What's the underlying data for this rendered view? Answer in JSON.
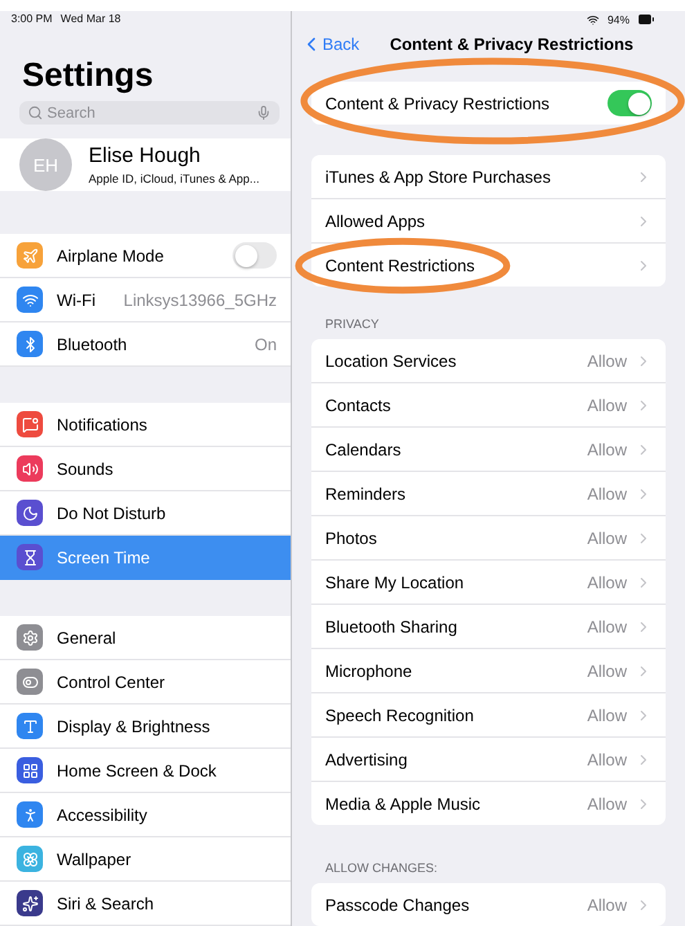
{
  "status_bar": {
    "time": "3:00 PM",
    "date": "Wed Mar 18",
    "battery": "94%"
  },
  "sidebar": {
    "title": "Settings",
    "search": {
      "placeholder": "Search"
    },
    "profile": {
      "initials": "EH",
      "name": "Elise Hough",
      "subtitle": "Apple ID, iCloud, iTunes & App..."
    },
    "groups": [
      [
        {
          "label": "Airplane Mode",
          "kind": "toggle",
          "on": false,
          "color": "#f7a23a",
          "selected": false
        },
        {
          "label": "Wi-Fi",
          "kind": "value",
          "value": "Linksys13966_5GHz",
          "color": "#2f86f0",
          "selected": false
        },
        {
          "label": "Bluetooth",
          "kind": "value",
          "value": "On",
          "color": "#2f86f0",
          "selected": false
        }
      ],
      [
        {
          "label": "Notifications",
          "kind": "plain",
          "color": "#ee4b3f",
          "selected": false
        },
        {
          "label": "Sounds",
          "kind": "plain",
          "color": "#ec3b5c",
          "selected": false
        },
        {
          "label": "Do Not Disturb",
          "kind": "plain",
          "color": "#5a4fd0",
          "selected": false
        },
        {
          "label": "Screen Time",
          "kind": "plain",
          "color": "#5a4fd0",
          "selected": true
        }
      ],
      [
        {
          "label": "General",
          "kind": "plain",
          "color": "#8e8e93",
          "selected": false
        },
        {
          "label": "Control Center",
          "kind": "plain",
          "color": "#8e8e93",
          "selected": false
        },
        {
          "label": "Display & Brightness",
          "kind": "plain",
          "color": "#2f86f0",
          "selected": false
        },
        {
          "label": "Home Screen & Dock",
          "kind": "plain",
          "color": "#3a5ee0",
          "selected": false
        },
        {
          "label": "Accessibility",
          "kind": "plain",
          "color": "#2f86f0",
          "selected": false
        },
        {
          "label": "Wallpaper",
          "kind": "plain",
          "color": "#3bb3e0",
          "selected": false
        },
        {
          "label": "Siri & Search",
          "kind": "plain",
          "color": "#3a3a8c",
          "selected": false
        }
      ]
    ]
  },
  "detail": {
    "back": "Back",
    "title": "Content & Privacy Restrictions",
    "sections": [
      {
        "rows": [
          {
            "label": "Content & Privacy Restrictions",
            "kind": "toggle",
            "on": true,
            "circled": true
          }
        ]
      },
      {
        "rows": [
          {
            "label": "iTunes & App Store Purchases",
            "kind": "link",
            "circled": false
          },
          {
            "label": "Allowed Apps",
            "kind": "link",
            "circled": false
          },
          {
            "label": "Content Restrictions",
            "kind": "link",
            "circled": true
          }
        ]
      },
      {
        "header": "PRIVACY",
        "rows": [
          {
            "label": "Location Services",
            "kind": "value",
            "value": "Allow",
            "circled": false
          },
          {
            "label": "Contacts",
            "kind": "value",
            "value": "Allow",
            "circled": false
          },
          {
            "label": "Calendars",
            "kind": "value",
            "value": "Allow",
            "circled": false
          },
          {
            "label": "Reminders",
            "kind": "value",
            "value": "Allow",
            "circled": false
          },
          {
            "label": "Photos",
            "kind": "value",
            "value": "Allow",
            "circled": false
          },
          {
            "label": "Share My Location",
            "kind": "value",
            "value": "Allow",
            "circled": false
          },
          {
            "label": "Bluetooth Sharing",
            "kind": "value",
            "value": "Allow",
            "circled": false
          },
          {
            "label": "Microphone",
            "kind": "value",
            "value": "Allow",
            "circled": false
          },
          {
            "label": "Speech Recognition",
            "kind": "value",
            "value": "Allow",
            "circled": false
          },
          {
            "label": "Advertising",
            "kind": "value",
            "value": "Allow",
            "circled": false
          },
          {
            "label": "Media & Apple Music",
            "kind": "value",
            "value": "Allow",
            "circled": false
          }
        ]
      },
      {
        "header": "ALLOW CHANGES:",
        "rows": [
          {
            "label": "Passcode Changes",
            "kind": "value",
            "value": "Allow",
            "circled": false
          }
        ]
      }
    ]
  }
}
